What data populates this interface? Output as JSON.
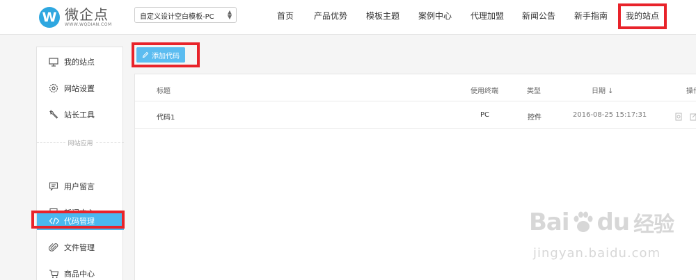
{
  "logo": {
    "name": "微企点",
    "url": "WWW.WQDIAN.COM",
    "mark": "W"
  },
  "template_select": {
    "value": "自定义设计空白模板-PC"
  },
  "nav": {
    "items": [
      {
        "label": "首页"
      },
      {
        "label": "产品优势"
      },
      {
        "label": "模板主题"
      },
      {
        "label": "案例中心"
      },
      {
        "label": "代理加盟"
      },
      {
        "label": "新闻公告"
      },
      {
        "label": "新手指南"
      },
      {
        "label": "我的站点"
      }
    ],
    "active_index": 7
  },
  "sidebar": {
    "items": [
      {
        "label": "我的站点",
        "icon": "monitor-icon"
      },
      {
        "label": "网站设置",
        "icon": "gear-icon"
      },
      {
        "label": "站长工具",
        "icon": "wrench-icon"
      },
      {
        "label": "用户留言",
        "icon": "message-icon"
      },
      {
        "label": "新闻中心",
        "icon": "document-icon"
      },
      {
        "label": "代码管理",
        "icon": "code-icon"
      },
      {
        "label": "文件管理",
        "icon": "paperclip-icon"
      },
      {
        "label": "商品中心",
        "icon": "cart-icon"
      }
    ],
    "section_label": "网站应用",
    "active_label": "代码管理"
  },
  "toolbar": {
    "add_label": "添加代码"
  },
  "table": {
    "headers": {
      "title": "标题",
      "terminal": "使用终端",
      "type": "类型",
      "date": "日期 ↓",
      "actions": "操作"
    },
    "rows": [
      {
        "title": "代码1",
        "terminal": "PC",
        "type": "控件",
        "date": "2016-08-25 15:17:31"
      }
    ]
  },
  "watermark": {
    "main_left": "Bai",
    "main_right": "du",
    "main_cn": "经验",
    "sub": "jingyan.baidu.com"
  },
  "colors": {
    "accent": "#4ab8ef",
    "button": "#5bbcf0",
    "highlight": "#e8232a",
    "logo": "#2ea7e0"
  }
}
